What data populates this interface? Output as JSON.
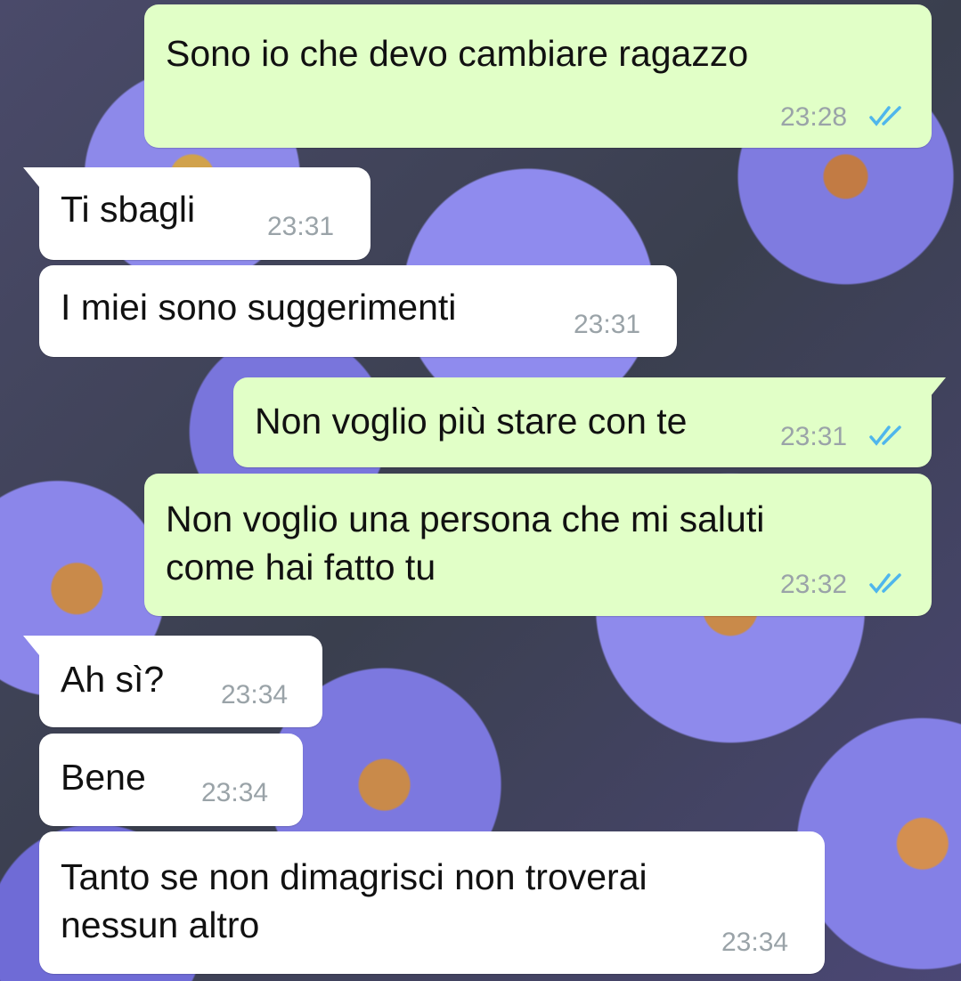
{
  "colors": {
    "outgoing_bubble": "#e1ffc7",
    "incoming_bubble": "#ffffff",
    "read_ticks": "#4fb6ec",
    "timestamp": "#9aa3a8"
  },
  "messages": [
    {
      "direction": "outgoing",
      "text": "Sono io che devo cambiare ragazzo",
      "time": "23:28",
      "status": "read",
      "status_icon": "double-check-icon"
    },
    {
      "direction": "incoming",
      "text": "Ti sbagli",
      "time": "23:31"
    },
    {
      "direction": "incoming",
      "text": "I miei sono suggerimenti",
      "time": "23:31"
    },
    {
      "direction": "outgoing",
      "text": "Non voglio più stare con te",
      "time": "23:31",
      "status": "read",
      "status_icon": "double-check-icon"
    },
    {
      "direction": "outgoing",
      "text": "Non voglio una persona che mi saluti\ncome hai fatto tu",
      "time": "23:32",
      "status": "read",
      "status_icon": "double-check-icon"
    },
    {
      "direction": "incoming",
      "text": "Ah sì?",
      "time": "23:34"
    },
    {
      "direction": "incoming",
      "text": "Bene",
      "time": "23:34"
    },
    {
      "direction": "incoming",
      "text": "Tanto se non dimagrisci non troverai\nnessun altro",
      "time": "23:34"
    }
  ]
}
